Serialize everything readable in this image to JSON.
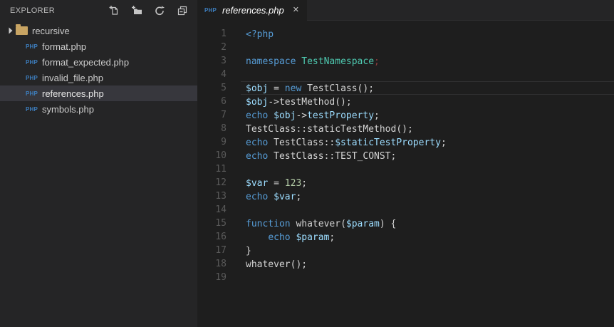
{
  "sidebar": {
    "header": {
      "title": "EXPLORER",
      "actions": [
        "new-file",
        "new-folder",
        "refresh",
        "collapse-all"
      ]
    },
    "tree": {
      "folder": {
        "label": "recursive",
        "collapsed": true
      },
      "files": [
        {
          "label": "format.php",
          "badge": "PHP",
          "selected": false
        },
        {
          "label": "format_expected.php",
          "badge": "PHP",
          "selected": false
        },
        {
          "label": "invalid_file.php",
          "badge": "PHP",
          "selected": false
        },
        {
          "label": "references.php",
          "badge": "PHP",
          "selected": true
        },
        {
          "label": "symbols.php",
          "badge": "PHP",
          "selected": false
        }
      ]
    }
  },
  "editor": {
    "tab": {
      "badge": "PHP",
      "title": "references.php",
      "close_glyph": "✕"
    },
    "current_line": 5,
    "code": {
      "lines": [
        {
          "num": 1,
          "tokens": [
            [
              "kw",
              "<?php"
            ]
          ]
        },
        {
          "num": 2,
          "tokens": []
        },
        {
          "num": 3,
          "tokens": [
            [
              "kw",
              "namespace"
            ],
            [
              "fg",
              " "
            ],
            [
              "type",
              "TestNamespace"
            ],
            [
              "err",
              ";"
            ]
          ]
        },
        {
          "num": 4,
          "tokens": []
        },
        {
          "num": 5,
          "tokens": [
            [
              "var",
              "$obj"
            ],
            [
              "fg",
              " = "
            ],
            [
              "kw",
              "new"
            ],
            [
              "fg",
              " TestClass();"
            ]
          ]
        },
        {
          "num": 6,
          "tokens": [
            [
              "var",
              "$obj"
            ],
            [
              "fg",
              "->testMethod();"
            ]
          ]
        },
        {
          "num": 7,
          "tokens": [
            [
              "kw",
              "echo"
            ],
            [
              "fg",
              " "
            ],
            [
              "var",
              "$obj"
            ],
            [
              "fg",
              "->"
            ],
            [
              "var",
              "testProperty"
            ],
            [
              "fg",
              ";"
            ]
          ]
        },
        {
          "num": 8,
          "tokens": [
            [
              "fg",
              "TestClass::staticTestMethod();"
            ]
          ]
        },
        {
          "num": 9,
          "tokens": [
            [
              "kw",
              "echo"
            ],
            [
              "fg",
              " TestClass::"
            ],
            [
              "var",
              "$staticTestProperty"
            ],
            [
              "fg",
              ";"
            ]
          ]
        },
        {
          "num": 10,
          "tokens": [
            [
              "kw",
              "echo"
            ],
            [
              "fg",
              " TestClass::TEST_CONST;"
            ]
          ]
        },
        {
          "num": 11,
          "tokens": []
        },
        {
          "num": 12,
          "tokens": [
            [
              "var",
              "$var"
            ],
            [
              "fg",
              " = "
            ],
            [
              "num",
              "123"
            ],
            [
              "fg",
              ";"
            ]
          ]
        },
        {
          "num": 13,
          "tokens": [
            [
              "kw",
              "echo"
            ],
            [
              "fg",
              " "
            ],
            [
              "var",
              "$var"
            ],
            [
              "fg",
              ";"
            ]
          ]
        },
        {
          "num": 14,
          "tokens": []
        },
        {
          "num": 15,
          "tokens": [
            [
              "kw",
              "function"
            ],
            [
              "fg",
              " whatever("
            ],
            [
              "var",
              "$param"
            ],
            [
              "fg",
              ") {"
            ]
          ]
        },
        {
          "num": 16,
          "tokens": [
            [
              "fg",
              "    "
            ],
            [
              "kw",
              "echo"
            ],
            [
              "fg",
              " "
            ],
            [
              "var",
              "$param"
            ],
            [
              "fg",
              ";"
            ]
          ]
        },
        {
          "num": 17,
          "tokens": [
            [
              "fg",
              "}"
            ]
          ]
        },
        {
          "num": 18,
          "tokens": [
            [
              "fg",
              "whatever();"
            ]
          ]
        },
        {
          "num": 19,
          "tokens": []
        }
      ]
    }
  },
  "palette": {
    "editor_bg": "#1E1E1E",
    "sidebar_bg": "#252526",
    "selected_row_bg": "#37373D",
    "keyword_blue": "#569CD6",
    "variable_blue": "#9CDCFE",
    "type_teal": "#4EC9B0",
    "number_green": "#B5CEA8",
    "default_text": "#D4D4D4",
    "line_number_gray": "#5A5A5A",
    "php_badge_blue": "#3D7EBE",
    "folder_tan": "#C8A463",
    "namespace_semicolon_red": "#8B3A3A",
    "current_line_border": "#303031"
  }
}
